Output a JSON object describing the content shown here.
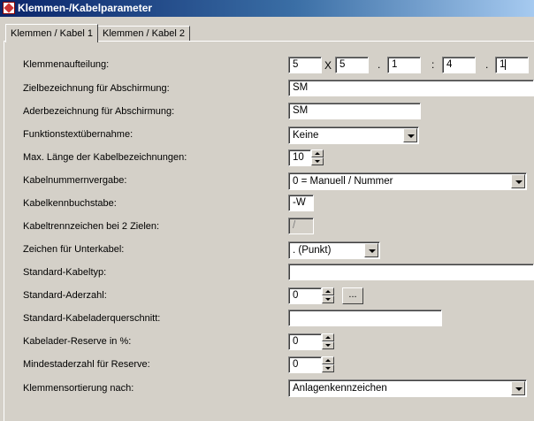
{
  "window": {
    "title": "Klemmen-/Kabelparameter",
    "icon": "app-icon"
  },
  "tabs": [
    {
      "label": "Klemmen / Kabel 1",
      "active": true
    },
    {
      "label": "Klemmen / Kabel 2",
      "active": false
    }
  ],
  "fields": {
    "klemmenaufteilung": {
      "label": "Klemmenaufteilung:",
      "values": [
        "5",
        "5",
        "1",
        "4",
        "1"
      ],
      "separators": [
        "X",
        ".",
        ":",
        "."
      ]
    },
    "zielbezeichnung": {
      "label": "Zielbezeichnung für Abschirmung:",
      "value": "SM"
    },
    "aderbezeichnung": {
      "label": "Aderbezeichnung für Abschirmung:",
      "value": "SM"
    },
    "funktionstext": {
      "label": "Funktionstextübernahme:",
      "value": "Keine"
    },
    "max_laenge": {
      "label": "Max. Länge der Kabelbezeichnungen:",
      "value": "10"
    },
    "kabelnummernvergabe": {
      "label": "Kabelnummernvergabe:",
      "value": "0 = Manuell / Nummer"
    },
    "kabelkennbuchstabe": {
      "label": "Kabelkennbuchstabe:",
      "value": "-W"
    },
    "kabeltrennzeichen": {
      "label": "Kabeltrennzeichen bei 2 Zielen:",
      "value": "/"
    },
    "zeichen_unterkabel": {
      "label": "Zeichen für Unterkabel:",
      "value": ". (Punkt)"
    },
    "standard_kabeltyp": {
      "label": "Standard-Kabeltyp:",
      "value": ""
    },
    "standard_aderzahl": {
      "label": "Standard-Aderzahl:",
      "value": "0",
      "button": "..."
    },
    "standard_querschnitt": {
      "label": "Standard-Kabeladerquerschnitt:",
      "value": ""
    },
    "reserve": {
      "label": "Kabelader-Reserve in %:",
      "value": "0"
    },
    "mindestaderzahl": {
      "label": "Mindestaderzahl für Reserve:",
      "value": "0"
    },
    "klemmensortierung": {
      "label": "Klemmensortierung nach:",
      "value": "Anlagenkennzeichen"
    }
  }
}
